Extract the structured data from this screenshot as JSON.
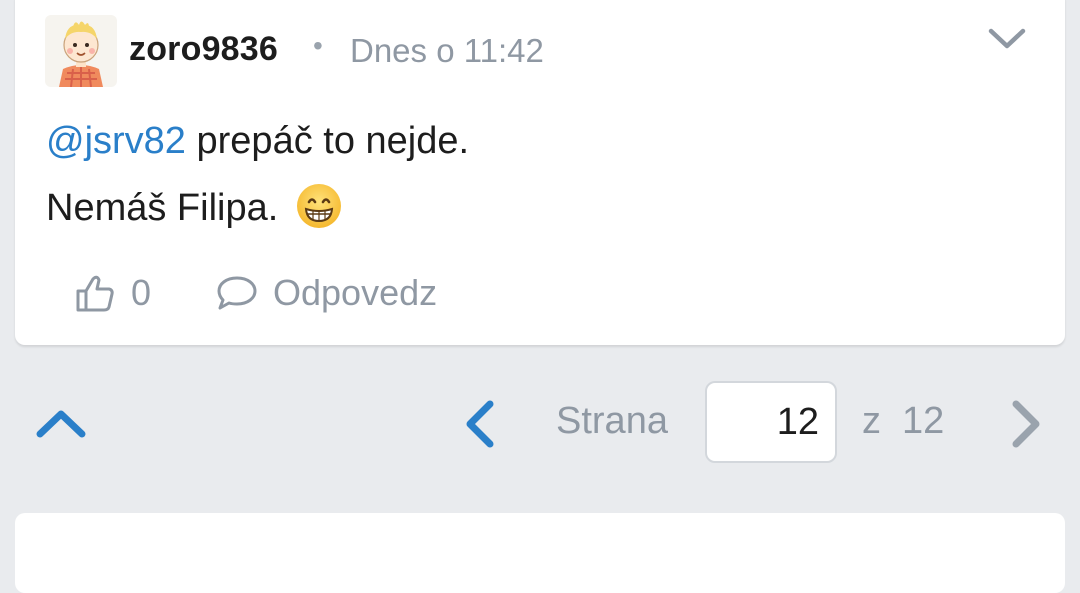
{
  "post": {
    "author": "zoro9836",
    "separator": "•",
    "timestamp": "Dnes o 11:42",
    "mention": "@jsrv82",
    "line1_text": " prepáč to nejde.",
    "line2_text": "Nemáš Filipa.",
    "emoji": "grinning-face-with-smiling-eyes",
    "likes": "0",
    "reply_label": "Odpovedz"
  },
  "pagination": {
    "label": "Strana",
    "current_page": "12",
    "of_label": "z",
    "total_pages": "12"
  },
  "colors": {
    "background": "#e9ebee",
    "card": "#ffffff",
    "accent_blue": "#2a7fc9",
    "muted_text": "#8f98a3",
    "text": "#1d1d1d"
  }
}
